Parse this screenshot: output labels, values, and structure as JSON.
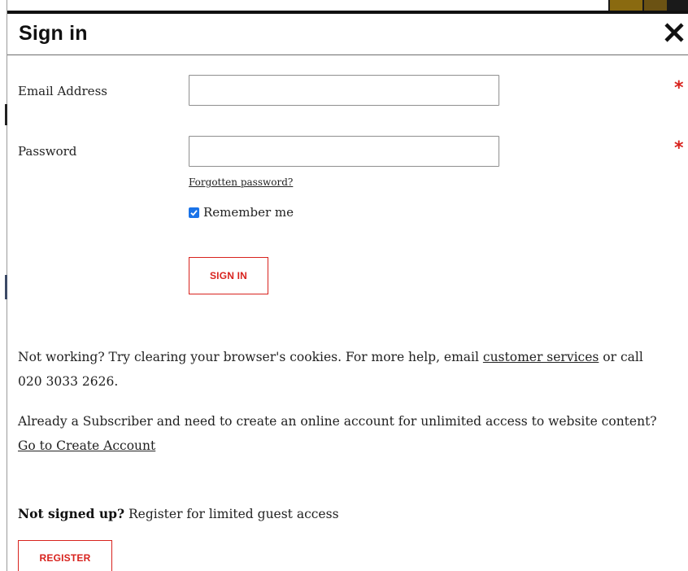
{
  "modal": {
    "title": "Sign in",
    "close_icon": "close-icon"
  },
  "form": {
    "email_label": "Email Address",
    "email_value": "",
    "password_label": "Password",
    "password_value": "",
    "required_marker": "*",
    "forgot_link": "Forgotten password?",
    "remember_label": "Remember me",
    "remember_checked": true,
    "signin_button": "SIGN IN"
  },
  "help": {
    "text_before": "Not working? Try clearing your browser's cookies. For more help, email ",
    "link": "customer services",
    "text_after": " or call 020 3033 2626."
  },
  "subscriber": {
    "text": "Already a Subscriber and need to create an online account for unlimited access to website content?",
    "link": "Go to Create Account"
  },
  "register": {
    "bold": "Not signed up?",
    "text": " Register for limited guest access",
    "button": "REGISTER"
  },
  "colors": {
    "accent_red": "#d8231e",
    "checkbox_blue": "#1a73e8"
  }
}
